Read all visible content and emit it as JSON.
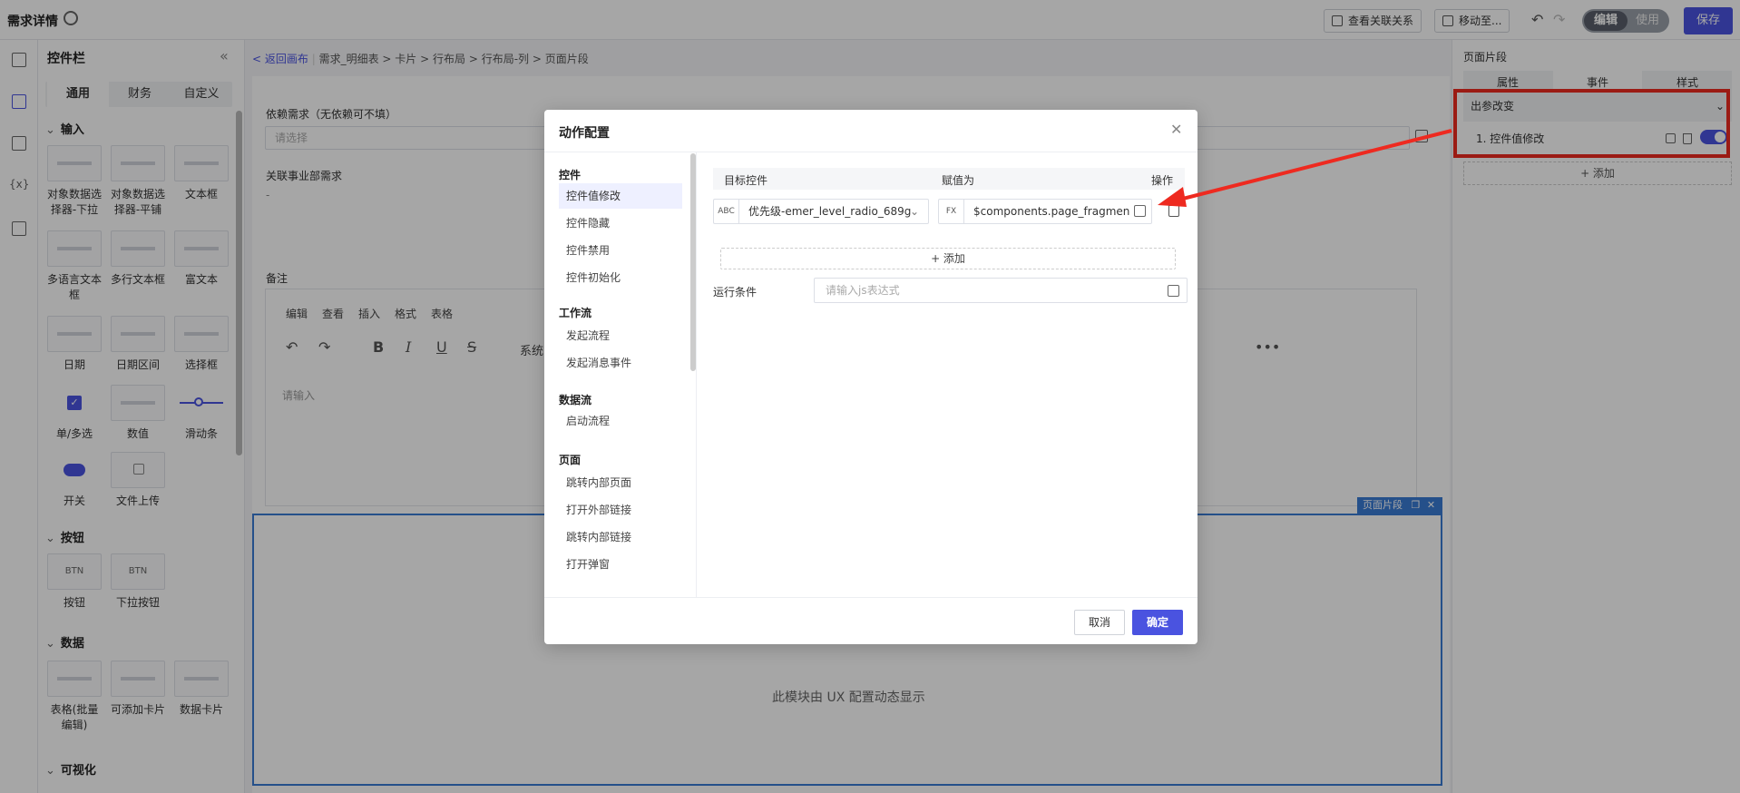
{
  "header": {
    "title": "需求详情",
    "view_relations": "查看关联关系",
    "move_to": "移动至...",
    "mode_edit": "编辑",
    "mode_use": "使用",
    "save": "保存"
  },
  "left_panel": {
    "title": "控件栏",
    "tabs": [
      "通用",
      "财务",
      "自定义"
    ],
    "sections": {
      "input": "输入",
      "button": "按钮",
      "data": "数据",
      "visual": "可视化"
    },
    "input_items": [
      [
        "对象数据选",
        "择器-下拉"
      ],
      [
        "对象数据选",
        "择器-平铺"
      ],
      [
        "文本框"
      ],
      [
        "多语言文本",
        "框"
      ],
      [
        "多行文本框"
      ],
      [
        "富文本"
      ],
      [
        "日期"
      ],
      [
        "日期区间"
      ],
      [
        "选择框"
      ],
      [
        "单/多选"
      ],
      [
        "数值"
      ],
      [
        "滑动条"
      ],
      [
        "开关"
      ],
      [
        "文件上传"
      ]
    ],
    "button_items": [
      [
        "按钮"
      ],
      [
        "下拉按钮"
      ]
    ],
    "button_icon_text": [
      "BTN",
      "BTN"
    ],
    "data_items": [
      [
        "表格(批量",
        "编辑)"
      ],
      [
        "可添加卡片"
      ],
      [
        "数据卡片"
      ]
    ]
  },
  "breadcrumb": {
    "back": "< 返回画布",
    "items": [
      "需求_明细表",
      "卡片",
      "行布局",
      "行布局-列",
      "页面片段"
    ]
  },
  "canvas": {
    "dep_label": "依赖需求（无依赖可不填）",
    "dep_placeholder": "请选择",
    "bu_label": "关联事业部需求",
    "bu_value": "-",
    "remark_label": "备注",
    "editor_menu": [
      "编辑",
      "查看",
      "插入",
      "格式",
      "表格"
    ],
    "editor_font": "系统",
    "editor_placeholder": "请输入",
    "fragment_tag": "页面片段",
    "fragment_text": "此模块由 UX 配置动态显示"
  },
  "right_panel": {
    "title": "页面片段",
    "tabs": [
      "属性",
      "事件",
      "样式"
    ],
    "event_name": "出参改变",
    "action_item": "1. 控件值修改",
    "add": "+ 添加"
  },
  "modal": {
    "title": "动作配置",
    "groups": [
      {
        "name": "控件",
        "items": [
          "控件值修改",
          "控件隐藏",
          "控件禁用",
          "控件初始化"
        ]
      },
      {
        "name": "工作流",
        "items": [
          "发起流程",
          "发起消息事件"
        ]
      },
      {
        "name": "数据流",
        "items": [
          "启动流程"
        ]
      },
      {
        "name": "页面",
        "items": [
          "跳转内部页面",
          "打开外部链接",
          "跳转内部链接",
          "打开弹窗"
        ]
      }
    ],
    "col_target": "目标控件",
    "col_value": "赋值为",
    "col_op": "操作",
    "target_prefix": "ABC",
    "target_value": "优先级-emer_level_radio_689g",
    "value_prefix": "FX",
    "value_expr": "$components.page_fragments_[",
    "add": "+ 添加",
    "cond_label": "运行条件",
    "cond_placeholder": "请输入js表达式",
    "cancel": "取消",
    "ok": "确定"
  },
  "colors": {
    "accent": "#4a53e0",
    "highlight": "#ee2a20",
    "fragment": "#3a7bd5"
  }
}
